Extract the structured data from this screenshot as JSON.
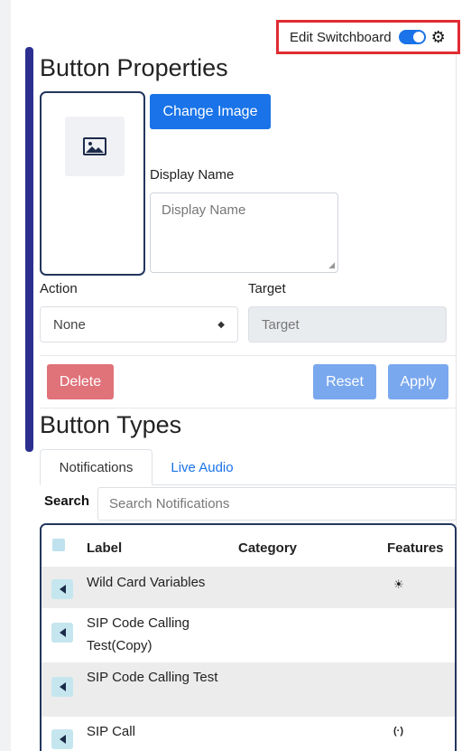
{
  "header": {
    "edit_switchboard_label": "Edit Switchboard",
    "toggle_on": true,
    "settings_icon": "gear-icon"
  },
  "button_properties": {
    "title": "Button Properties",
    "change_image_label": "Change Image",
    "image_icon": "image-icon",
    "display_name_label": "Display Name",
    "display_name_placeholder": "Display Name",
    "action_label": "Action",
    "action_value": "None",
    "target_label": "Target",
    "target_placeholder": "Target",
    "delete_label": "Delete",
    "reset_label": "Reset",
    "apply_label": "Apply"
  },
  "button_types": {
    "title": "Button Types",
    "tabs": [
      {
        "label": "Notifications",
        "active": true
      },
      {
        "label": "Live Audio",
        "active": false
      }
    ],
    "search_label": "Search",
    "search_placeholder": "Search Notifications",
    "columns": [
      "Label",
      "Category",
      "Features"
    ],
    "rows": [
      {
        "label": "Wild Card Variables",
        "category": "",
        "feature_icon": "sun-icon",
        "feature_glyph": "☀"
      },
      {
        "label": "SIP Code Calling Test(Copy)",
        "category": "",
        "feature_icon": "",
        "feature_glyph": ""
      },
      {
        "label": "SIP Code Calling Test",
        "category": "",
        "feature_icon": "",
        "feature_glyph": ""
      },
      {
        "label": "SIP Call",
        "category": "",
        "feature_icon": "broadcast-icon",
        "feature_glyph": "(·)"
      }
    ]
  },
  "colors": {
    "primary": "#1a73e8",
    "danger": "#e0727a",
    "highlight_border": "#e02b33",
    "card_border": "#23365d",
    "row_shade": "#ececec"
  }
}
